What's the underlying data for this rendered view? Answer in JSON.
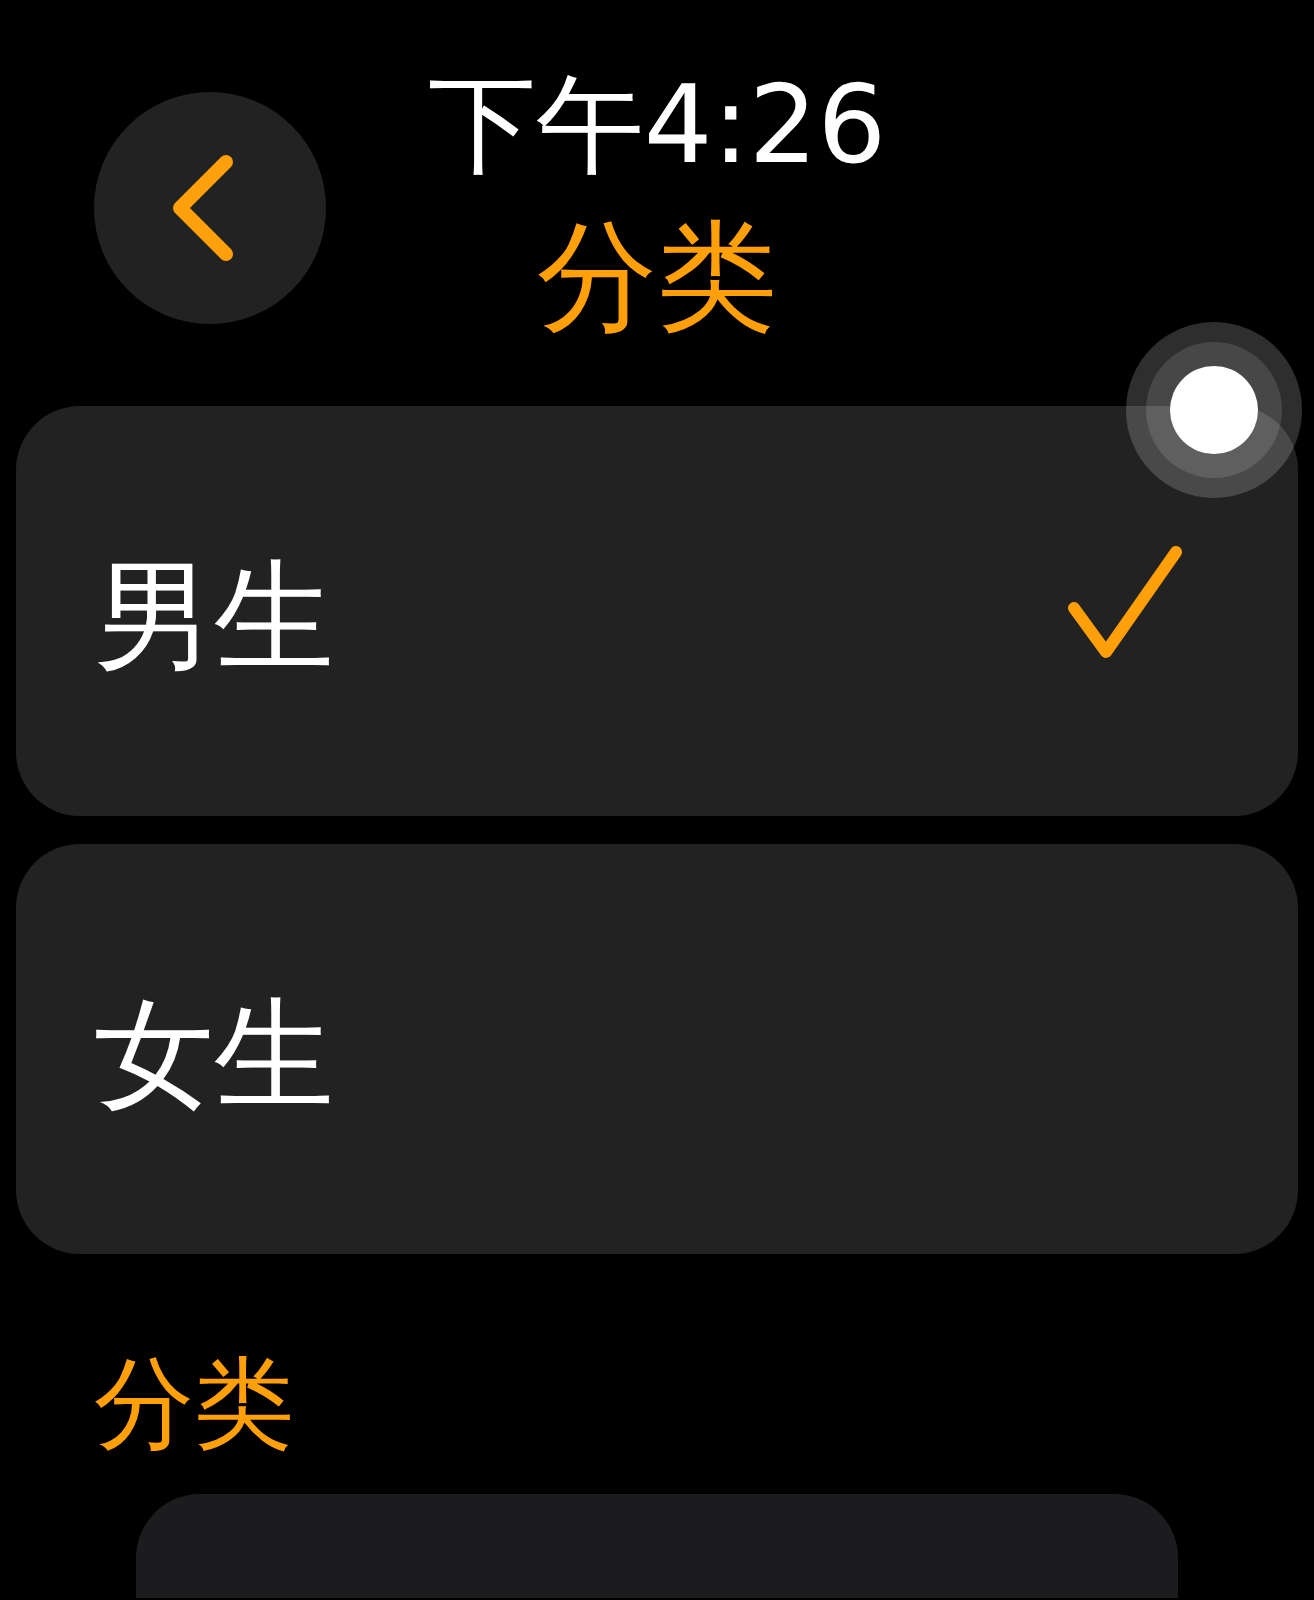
{
  "status": {
    "time": "下午4:26"
  },
  "nav": {
    "title": "分类"
  },
  "options": [
    {
      "label": "男生",
      "selected": true
    },
    {
      "label": "女生",
      "selected": false
    }
  ],
  "section": {
    "title": "分类"
  }
}
